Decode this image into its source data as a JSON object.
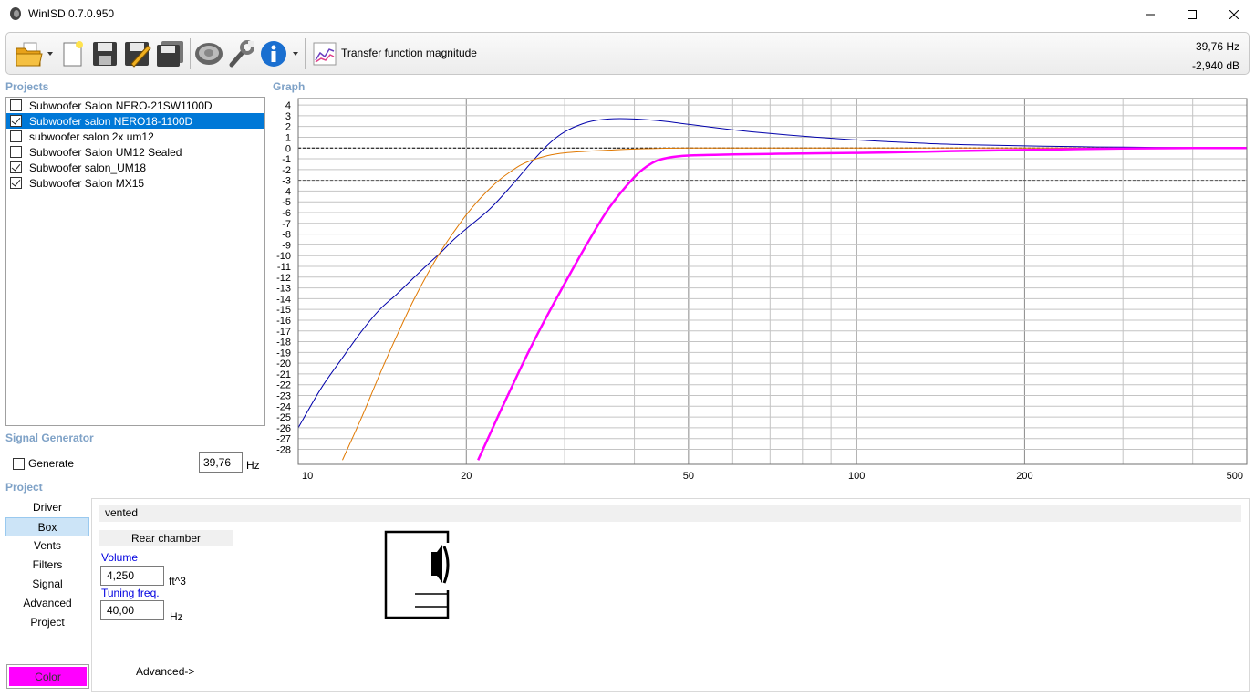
{
  "window": {
    "title": "WinISD 0.7.0.950"
  },
  "toolbar": {
    "graph_type": "Transfer function magnitude",
    "cursor_freq": "39,76 Hz",
    "cursor_db": "-2,940 dB",
    "icons": [
      "open-folder-icon",
      "new-document-icon",
      "save-icon",
      "save-edit-icon",
      "save-all-icon",
      "driver-icon",
      "wrench-icon",
      "info-icon",
      "graph-icon"
    ]
  },
  "projects": {
    "title": "Projects",
    "items": [
      {
        "label": "Subwoofer Salon NERO-21SW1100D",
        "checked": false,
        "selected": false
      },
      {
        "label": "Subwoofer salon NERO18-1100D",
        "checked": true,
        "selected": true
      },
      {
        "label": "subwoofer salon 2x um12",
        "checked": false,
        "selected": false
      },
      {
        "label": "Subwoofer Salon UM12 Sealed",
        "checked": false,
        "selected": false
      },
      {
        "label": "Subwoofer salon_UM18",
        "checked": true,
        "selected": false
      },
      {
        "label": "Subwoofer Salon MX15",
        "checked": true,
        "selected": false
      }
    ]
  },
  "signal_generator": {
    "title": "Signal Generator",
    "generate_label": "Generate",
    "frequency": "39,76",
    "unit": "Hz"
  },
  "graph": {
    "title": "Graph",
    "y_ticks": [
      "4",
      "3",
      "2",
      "1",
      "0",
      "-1",
      "-2",
      "-3",
      "-4",
      "-5",
      "-6",
      "-7",
      "-8",
      "-9",
      "-10",
      "-11",
      "-12",
      "-13",
      "-14",
      "-15",
      "-16",
      "-17",
      "-18",
      "-19",
      "-20",
      "-21",
      "-22",
      "-23",
      "-24",
      "-25",
      "-26",
      "-27",
      "-28"
    ],
    "x_tick_labels": [
      "10",
      "20",
      "50",
      "100",
      "200",
      "500"
    ]
  },
  "chart_data": {
    "type": "line",
    "x_scale": "log",
    "xlim": [
      10,
      500
    ],
    "ylim": [
      -29,
      5
    ],
    "y_ticks": [
      4,
      3,
      2,
      1,
      0,
      -1,
      -2,
      -3,
      -4,
      -5,
      -6,
      -7,
      -8,
      -9,
      -10,
      -11,
      -12,
      -13,
      -14,
      -15,
      -16,
      -17,
      -18,
      -19,
      -20,
      -21,
      -22,
      -23,
      -24,
      -25,
      -26,
      -27,
      -28
    ],
    "x_ticks": [
      10,
      20,
      50,
      100,
      200,
      500
    ],
    "grid": true,
    "reference_lines": [
      0,
      -3
    ],
    "series": [
      {
        "color": "#0000aa",
        "width": 1,
        "x": [
          10,
          11,
          12,
          13,
          14,
          15,
          16,
          17,
          18,
          19,
          20,
          22,
          24,
          26,
          28,
          30,
          33,
          36,
          40,
          45,
          50,
          60,
          70,
          80,
          100,
          130,
          160,
          200,
          250,
          300,
          400,
          450
        ],
        "y": [
          -26,
          -22.3,
          -19.5,
          -17,
          -15,
          -13.6,
          -12.2,
          -10.9,
          -9.7,
          -8.5,
          -7.5,
          -5.7,
          -3.6,
          -1.5,
          0.3,
          1.5,
          2.4,
          2.7,
          2.7,
          2.5,
          2.2,
          1.7,
          1.35,
          1.1,
          0.75,
          0.45,
          0.3,
          0.2,
          0.12,
          0.08,
          0.04,
          0.02
        ]
      },
      {
        "color": "#e07800",
        "width": 1,
        "x": [
          12,
          13,
          14,
          15,
          16,
          17,
          18,
          19,
          20,
          21,
          22,
          23,
          24,
          25,
          26,
          28,
          30,
          33,
          36,
          40,
          50,
          70,
          100,
          150,
          200,
          300,
          450
        ],
        "y": [
          -29,
          -25,
          -21,
          -17.5,
          -14.4,
          -11.8,
          -9.6,
          -7.8,
          -6.2,
          -4.9,
          -3.8,
          -2.9,
          -2.2,
          -1.6,
          -1.2,
          -0.7,
          -0.45,
          -0.3,
          -0.2,
          -0.1,
          0,
          0,
          0,
          0,
          0,
          0,
          0
        ]
      },
      {
        "color": "#ff00ff",
        "width": 2.5,
        "x": [
          21,
          23,
          25,
          27,
          30,
          33,
          36,
          40,
          43,
          46,
          50,
          60,
          70,
          80,
          100,
          130,
          160,
          200,
          250,
          300,
          400,
          500
        ],
        "y": [
          -29,
          -24.5,
          -20.5,
          -17,
          -12.6,
          -8.8,
          -5.6,
          -2.7,
          -1.4,
          -0.9,
          -0.7,
          -0.6,
          -0.55,
          -0.5,
          -0.45,
          -0.35,
          -0.25,
          -0.18,
          -0.1,
          -0.05,
          0,
          0
        ]
      }
    ]
  },
  "project": {
    "title": "Project",
    "nav": [
      "Driver",
      "Box",
      "Vents",
      "Filters",
      "Signal",
      "Advanced",
      "Project"
    ],
    "active_nav": "Box",
    "color_label": "Color",
    "color_value": "#ff00ff"
  },
  "box": {
    "type": "vented",
    "rear_chamber": "Rear chamber",
    "volume_label": "Volume",
    "volume": "4,250",
    "volume_unit": "ft^3",
    "tuning_label": "Tuning freq.",
    "tuning": "40,00",
    "tuning_unit": "Hz",
    "advanced_link": "Advanced->"
  }
}
